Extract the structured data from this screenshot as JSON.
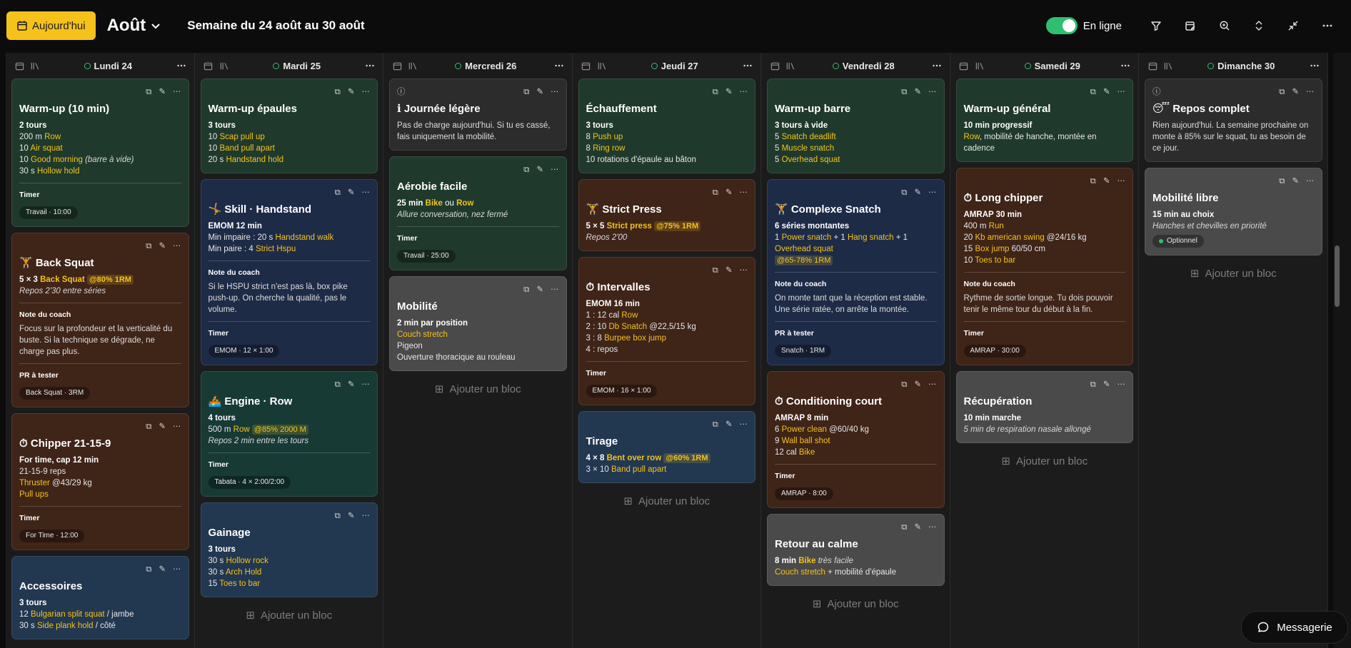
{
  "topbar": {
    "today": "Aujourd'hui",
    "month": "Août",
    "week": "Semaine du 24 août au 30 août",
    "online_label": "En ligne",
    "online_on": true
  },
  "add_block": "Ajouter un bloc",
  "messenger": "Messagerie",
  "days": [
    {
      "label": "Lundi 24"
    },
    {
      "label": "Mardi 25"
    },
    {
      "label": "Mercredi 26"
    },
    {
      "label": "Jeudi 27"
    },
    {
      "label": "Vendredi 28"
    },
    {
      "label": "Samedi 29"
    },
    {
      "label": "Dimanche 30"
    }
  ],
  "cards": {
    "mon_warmup": {
      "title": "Warm-up (10 min)",
      "l1": "2 tours",
      "l2a": "200 m ",
      "l2b": "Row",
      "l3a": "10 ",
      "l3b": "Air squat",
      "l4a": "10 ",
      "l4b": "Good morning",
      "l4c": " (barre à vide)",
      "l5a": "30 s ",
      "l5b": "Hollow hold",
      "timer_label": "Timer",
      "timer": "Travail · 10:00"
    },
    "mon_squat": {
      "title": "🏋 Back Squat",
      "l1a": "5 × 3 ",
      "l1b": "Back Squat",
      "l1c": "@80% 1RM",
      "l2": "Repos 2'30 entre séries",
      "note_label": "Note du coach",
      "note": "Focus sur la profondeur et la verticalité du buste. Si la technique se dégrade, ne charge pas plus.",
      "pr_label": "PR à tester",
      "pr": "Back Squat · 3RM"
    },
    "mon_chipper": {
      "title": "⏱ Chipper 21-15-9",
      "l1": "For time, cap 12 min",
      "l2": "21-15-9 reps",
      "l3a": "Thruster",
      "l3b": " @43/29 kg",
      "l4": "Pull ups",
      "timer_label": "Timer",
      "timer": "For Time · 12:00"
    },
    "mon_acc": {
      "title": "Accessoires",
      "l1": "3 tours",
      "l2a": "12 ",
      "l2b": "Bulgarian split squat",
      "l2c": " / jambe",
      "l3a": "30 s ",
      "l3b": "Side plank hold",
      "l3c": " / côté"
    },
    "tue_warmup": {
      "title": "Warm-up épaules",
      "l1": "3 tours",
      "l2a": "10 ",
      "l2b": "Scap pull up",
      "l3a": "10 ",
      "l3b": "Band pull apart",
      "l4a": "20 s ",
      "l4b": "Handstand hold"
    },
    "tue_skill": {
      "title": "🤸 Skill · Handstand",
      "l1": "EMOM 12 min",
      "l2a": "Min impaire : 20 s ",
      "l2b": "Handstand walk",
      "l3a": "Min paire : 4 ",
      "l3b": "Strict Hspu",
      "note_label": "Note du coach",
      "note": "Si le HSPU strict n'est pas là, box pike push-up. On cherche la qualité, pas le volume.",
      "timer_label": "Timer",
      "timer": "EMOM · 12 × 1:00"
    },
    "tue_engine": {
      "title": "🚣 Engine · Row",
      "l1": "4 tours",
      "l2a": "500 m ",
      "l2b": "Row",
      "l2c": "@85% 2000 M",
      "l3": "Repos 2 min entre les tours",
      "timer_label": "Timer",
      "timer": "Tabata · 4 × 2:00/2:00"
    },
    "tue_gainage": {
      "title": "Gainage",
      "l1": "3 tours",
      "l2a": "30 s ",
      "l2b": "Hollow rock",
      "l3a": "30 s ",
      "l3b": "Arch Hold",
      "l4a": "15 ",
      "l4b": "Toes to bar"
    },
    "wed_light": {
      "title": "ℹ Journée légère",
      "text": "Pas de charge aujourd'hui. Si tu es cassé, fais uniquement la mobilité."
    },
    "wed_aero": {
      "title": "Aérobie facile",
      "l1a": "25 min ",
      "l1b": "Bike",
      "l1c": " ou ",
      "l1d": "Row",
      "l2": "Allure conversation, nez fermé",
      "timer_label": "Timer",
      "timer": "Travail · 25:00"
    },
    "wed_mob": {
      "title": "Mobilité",
      "l1": "2 min par position",
      "l2": "Couch stretch",
      "l3": "Pigeon",
      "l4": "Ouverture thoracique au rouleau"
    },
    "thu_warm": {
      "title": "Échauffement",
      "l1": "3 tours",
      "l2a": "8 ",
      "l2b": "Push up",
      "l3a": "8 ",
      "l3b": "Ring row",
      "l4": "10 rotations d'épaule au bâton"
    },
    "thu_press": {
      "title": "🏋 Strict Press",
      "l1a": "5 × 5 ",
      "l1b": "Strict press",
      "l1c": "@75% 1RM",
      "l2": "Repos 2'00"
    },
    "thu_int": {
      "title": "⏱ Intervalles",
      "l1": "EMOM 16 min",
      "l2a": "1 : 12 cal ",
      "l2b": "Row",
      "l3a": "2 : 10 ",
      "l3b": "Db Snatch",
      "l3c": " @22,5/15 kg",
      "l4a": "3 : 8 ",
      "l4b": "Burpee box jump",
      "l5": "4 : repos",
      "timer_label": "Timer",
      "timer": "EMOM · 16 × 1:00"
    },
    "thu_tirage": {
      "title": "Tirage",
      "l1a": "4 × 8 ",
      "l1b": "Bent over row",
      "l1c": "@60% 1RM",
      "l2a": "3 × 10 ",
      "l2b": "Band pull apart"
    },
    "fri_warm": {
      "title": "Warm-up barre",
      "l1": "3 tours à vide",
      "l2a": "5 ",
      "l2b": "Snatch deadlift",
      "l3a": "5 ",
      "l3b": "Muscle snatch",
      "l4a": "5 ",
      "l4b": "Overhead squat"
    },
    "fri_snatch": {
      "title": "🏋 Complexe Snatch",
      "l1": "6 séries montantes",
      "l2a": "1 ",
      "l2b": "Power snatch",
      "l2c": " + 1 ",
      "l2d": "Hang snatch",
      "l2e": " + 1 ",
      "l3": "Overhead squat",
      "l4": "@65-78% 1RM",
      "note_label": "Note du coach",
      "note": "On monte tant que la réception est stable. Une série ratée, on arrête la montée.",
      "pr_label": "PR à tester",
      "pr": "Snatch · 1RM"
    },
    "fri_cond": {
      "title": "⏱ Conditioning court",
      "l1": "AMRAP 8 min",
      "l2a": "6 ",
      "l2b": "Power clean",
      "l2c": " @60/40 kg",
      "l3a": "9 ",
      "l3b": "Wall ball shot",
      "l4a": "12 cal ",
      "l4b": "Bike",
      "timer_label": "Timer",
      "timer": "AMRAP · 8:00"
    },
    "fri_calm": {
      "title": "Retour au calme",
      "l1a": "8 min ",
      "l1b": "Bike",
      "l1c": " très facile",
      "l2a": "Couch stretch",
      "l2b": " + mobilité d'épaule"
    },
    "sat_warm": {
      "title": "Warm-up général",
      "l1": "10 min progressif",
      "l2a": "Row",
      "l2b": ", mobilité de hanche, montée en cadence"
    },
    "sat_chip": {
      "title": "⏱ Long chipper",
      "l1": "AMRAP 30 min",
      "l2a": "400 m ",
      "l2b": "Run",
      "l3a": "20 ",
      "l3b": "Kb american swing",
      "l3c": " @24/16 kg",
      "l4a": "15 ",
      "l4b": "Box jump",
      "l4c": " 60/50 cm",
      "l5a": "10 ",
      "l5b": "Toes to bar",
      "note_label": "Note du coach",
      "note": "Rythme de sortie longue. Tu dois pouvoir tenir le même tour du début à la fin.",
      "timer_label": "Timer",
      "timer": "AMRAP · 30:00"
    },
    "sat_recup": {
      "title": "Récupération",
      "l1": "10 min marche",
      "l2": "5 min de respiration nasale allongé"
    },
    "sun_rest": {
      "title": "😴 Repos complet",
      "text": "Rien aujourd'hui. La semaine prochaine on monte à 85% sur le squat, tu as besoin de ce jour."
    },
    "sun_mob": {
      "title": "Mobilité libre",
      "l1": "15 min au choix",
      "l2": "Hanches et chevilles en priorité",
      "chip": "Optionnel"
    }
  }
}
